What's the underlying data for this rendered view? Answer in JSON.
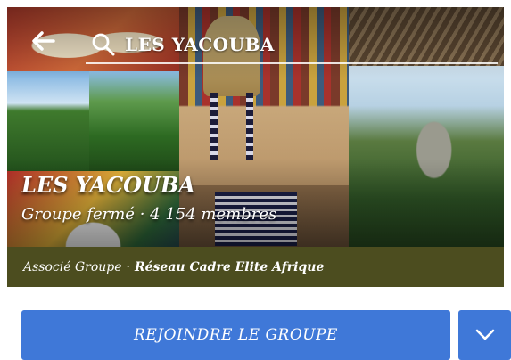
{
  "header": {
    "back_icon": "arrow-left-icon",
    "search_icon": "search-icon",
    "search_query": "LES YACOUBA"
  },
  "group": {
    "title": "LES YACOUBA",
    "privacy": "Groupe fermé",
    "meta_separator": "·",
    "member_count": "4 154 membres",
    "associated_label": "Associé Groupe",
    "associated_org": "Réseau Cadre Elite Afrique"
  },
  "actions": {
    "join_label": "REJOINDRE LE GROUPE",
    "dropdown_icon": "chevron-down-icon"
  },
  "colors": {
    "primary_button": "#3f78d8",
    "association_bar": "#4c4d1f",
    "text": "#ffffff"
  }
}
